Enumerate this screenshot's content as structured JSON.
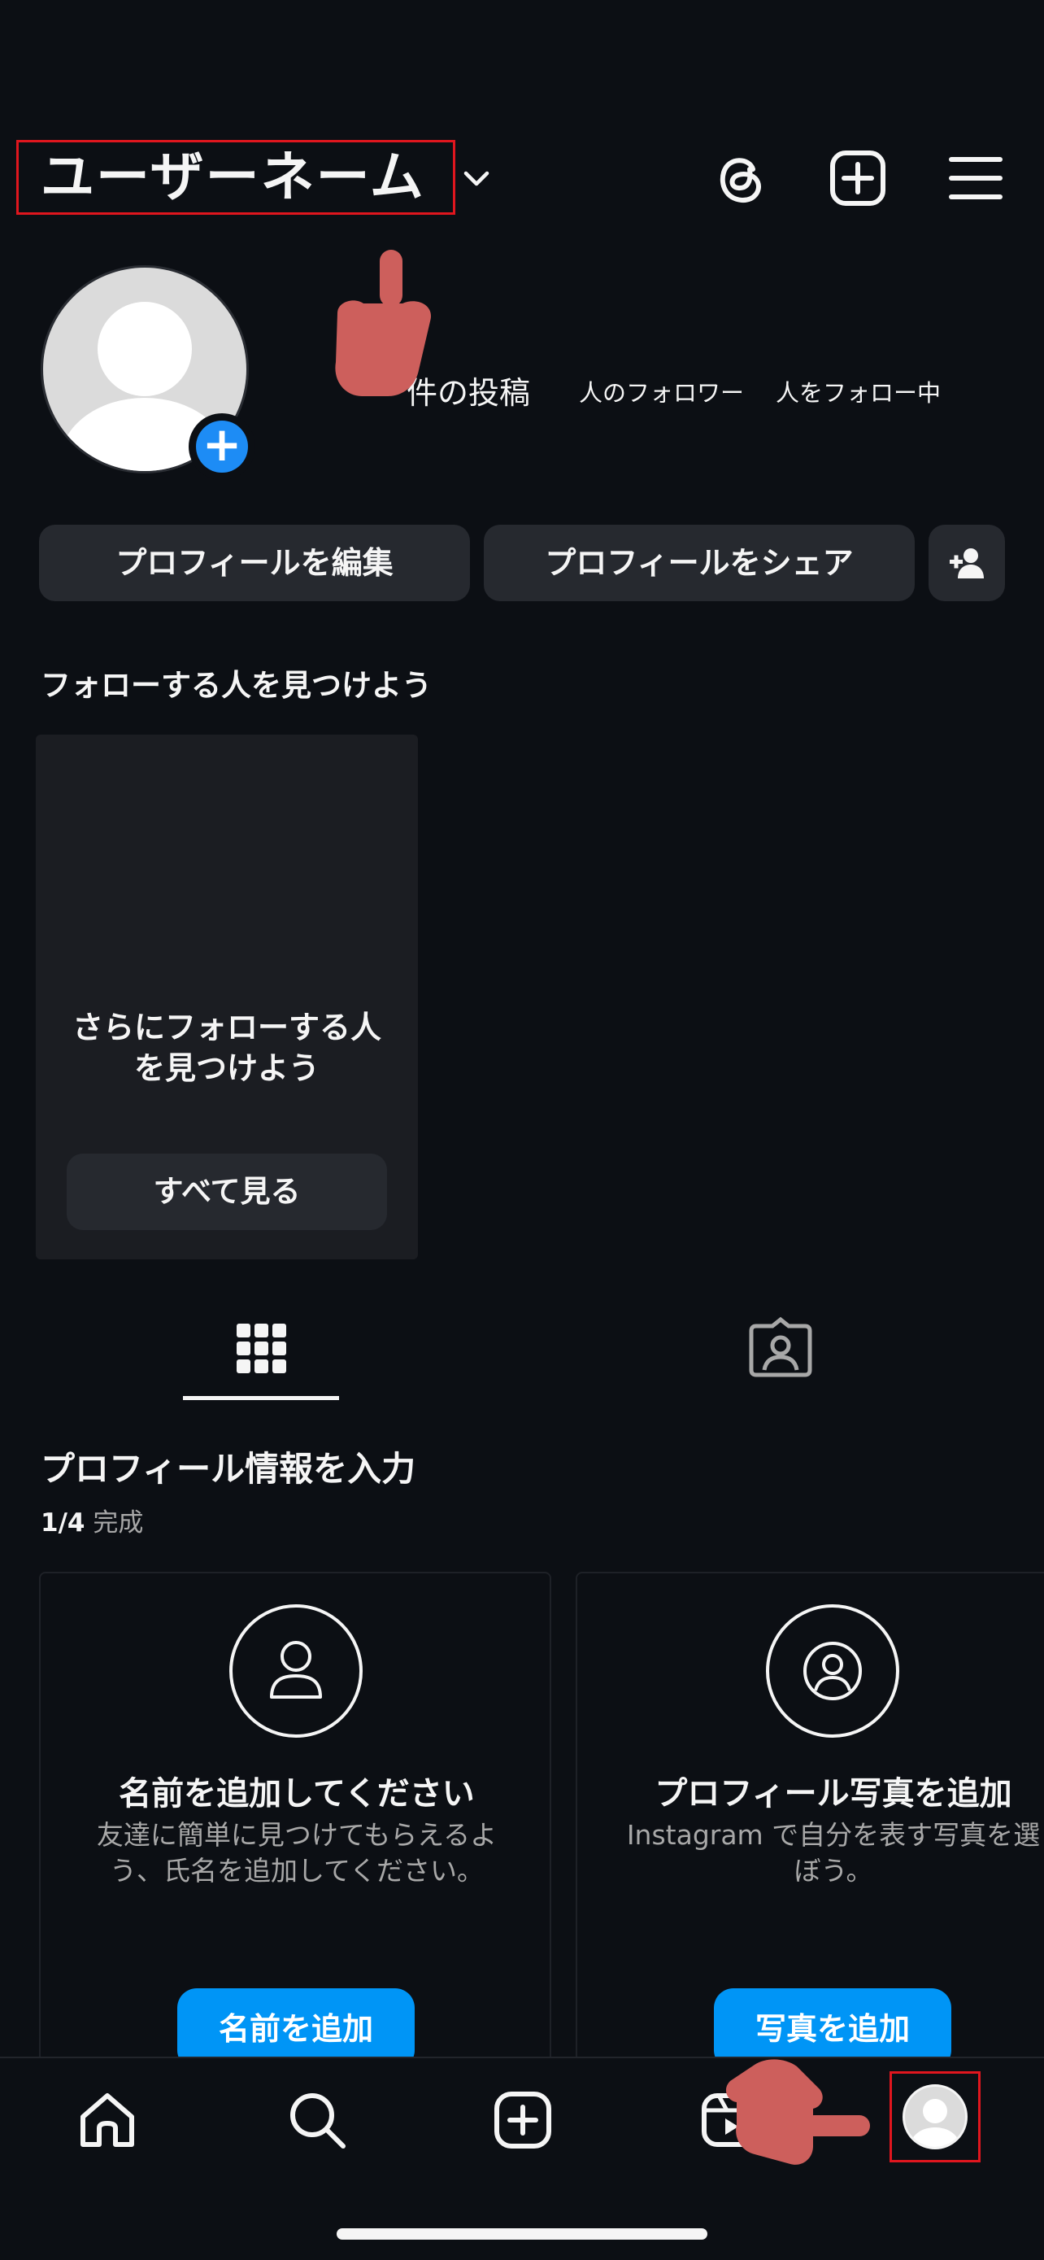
{
  "header": {
    "username": "ユーザーネーム",
    "icons": [
      "chevron-down-icon",
      "threads-icon",
      "plus-square-icon",
      "hamburger-menu-icon"
    ]
  },
  "profile": {
    "posts_label": "件の投稿",
    "followers_label": "人のフォロワー",
    "following_label": "人をフォロー中",
    "avatar_badge": "+"
  },
  "actions": {
    "edit_profile": "プロフィールを編集",
    "share_profile": "プロフィールをシェア",
    "add_person_icon": "person-add-icon"
  },
  "discover": {
    "title": "フォローする人を見つけよう",
    "card_text": "さらにフォローする人\nを見つけよう",
    "see_all": "すべて見る"
  },
  "tabs": [
    {
      "icon": "grid-icon",
      "active": true
    },
    {
      "icon": "tagged-person-icon",
      "active": false
    }
  ],
  "complete_profile": {
    "title": "プロフィール情報を入力",
    "progress_count": "1/4",
    "progress_label": "完成",
    "cards": [
      {
        "icon": "person-outline-icon",
        "title": "名前を追加してください",
        "description": "友達に簡単に見つけてもらえるよう、氏名を追加してください。",
        "button": "名前を追加"
      },
      {
        "icon": "person-circle-icon",
        "title": "プロフィール写真を追加",
        "description": "Instagram で自分を表す写真を選ぼう。",
        "button": "写真を追加"
      }
    ]
  },
  "bottom_nav": {
    "items": [
      "home-icon",
      "search-icon",
      "create-icon",
      "reels-icon",
      "profile-avatar"
    ],
    "active": "profile-avatar"
  },
  "colors": {
    "background": "#0c0f14",
    "button": "#26292f",
    "accent_blue": "#0095f6",
    "highlight_red": "#e0161e",
    "pointer_hand": "#cd5f5c"
  }
}
